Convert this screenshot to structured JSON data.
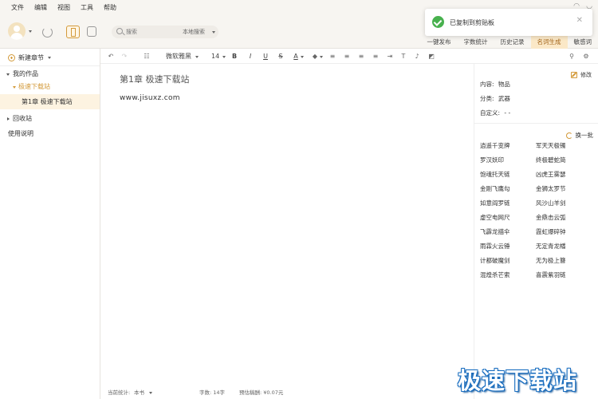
{
  "menubar": {
    "items": [
      "文件",
      "编辑",
      "视图",
      "工具",
      "帮助"
    ]
  },
  "search": {
    "placeholder": "搜索",
    "scope": "本地搜索"
  },
  "top_tabs": [
    "一键发布",
    "字数统计",
    "历史记录",
    "名词生成",
    "敏感词"
  ],
  "top_tabs_active": "名词生成",
  "toast": {
    "message": "已复制到剪贴板"
  },
  "sidebar": {
    "new_chapter": "新建章节",
    "my_works": "我的作品",
    "book": "极速下载站",
    "chapter": "第1章 极速下载站",
    "recycle": "回收站",
    "guide": "使用说明"
  },
  "editor_toolbar": {
    "font": "微软雅黑",
    "size": "14"
  },
  "editor": {
    "title": "第1章 极速下载站",
    "body": "www.jisuxz.com"
  },
  "statusbar": {
    "stat_label": "当前统计:",
    "stat_scope": "本书",
    "words": "字数: 14字",
    "fee": "预估稿酬: ¥0.07元"
  },
  "right_panel": {
    "edit": "修改",
    "content_label": "内容:",
    "content_value": "物品",
    "category_label": "分类:",
    "category_value": "武器",
    "custom_label": "自定义:",
    "custom_value": "- -",
    "refresh": "换一批",
    "names_left": [
      "逍遥千变牌",
      "罗汉妖印",
      "饱魂托天链",
      "金刚飞鹰勾",
      "如意阎罗链",
      "虚空电网尺",
      "飞霹龙描伞",
      "雨霖火云锤",
      "计都破魔剑",
      "混煌杀芒索"
    ],
    "names_right": [
      "军天天极镯",
      "终极碧蛇简",
      "凶虎王雾瑟",
      "金狮太罗节",
      "风沙山羊剑",
      "金鼎击云弧",
      "霞虹爆碎钟",
      "无定青龙幡",
      "无为极上簪",
      "喜震紫羽链"
    ]
  },
  "watermark": "极速下载站",
  "colors": {
    "accent": "#d39a3a",
    "active_tab_bg": "#fbe8c7",
    "toast_ok": "#48b14e"
  }
}
